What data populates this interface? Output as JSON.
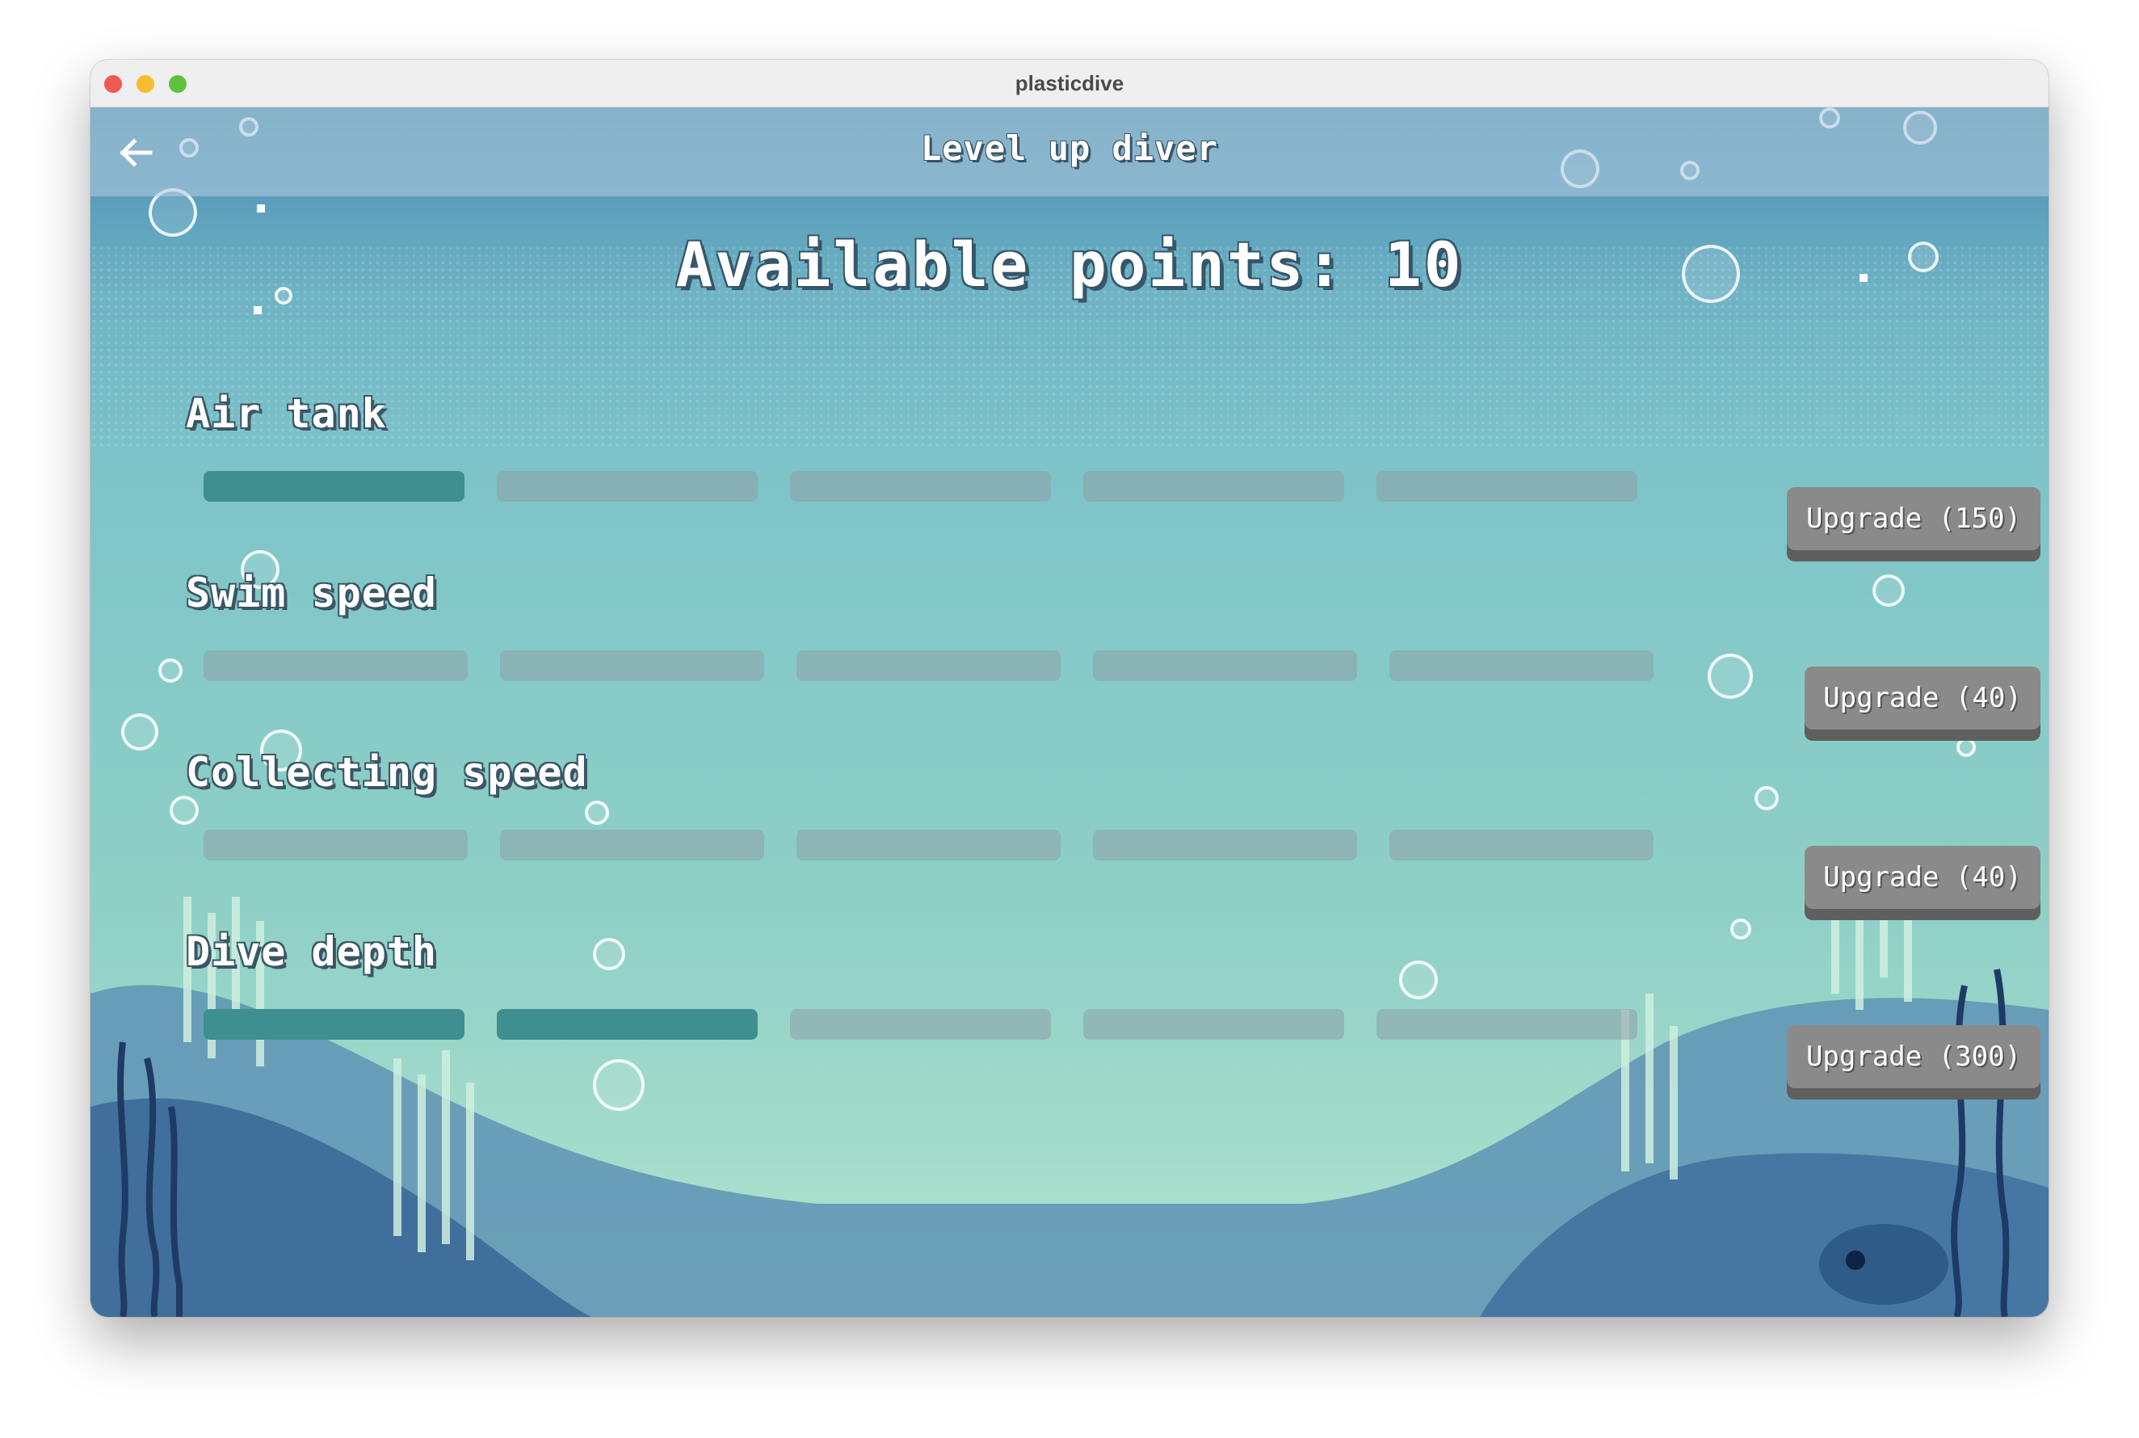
{
  "window": {
    "title": "plasticdive"
  },
  "header": {
    "back_icon": "arrow-left-icon",
    "title": "Level up diver"
  },
  "points": {
    "label": "Available points: 10",
    "value": 10
  },
  "upgrades": [
    {
      "name": "Air tank",
      "level": 1,
      "max_level": 5,
      "button_label": "Upgrade (150)"
    },
    {
      "name": "Swim speed",
      "level": 0,
      "max_level": 5,
      "button_label": "Upgrade (40)"
    },
    {
      "name": "Collecting speed",
      "level": 0,
      "max_level": 5,
      "button_label": "Upgrade (40)"
    },
    {
      "name": "Dive depth",
      "level": 2,
      "max_level": 5,
      "button_label": "Upgrade (300)"
    }
  ],
  "colors": {
    "segment_filled": "#3f8e90",
    "segment_empty": "#8ca0a5",
    "button": "#8a8a8a"
  }
}
